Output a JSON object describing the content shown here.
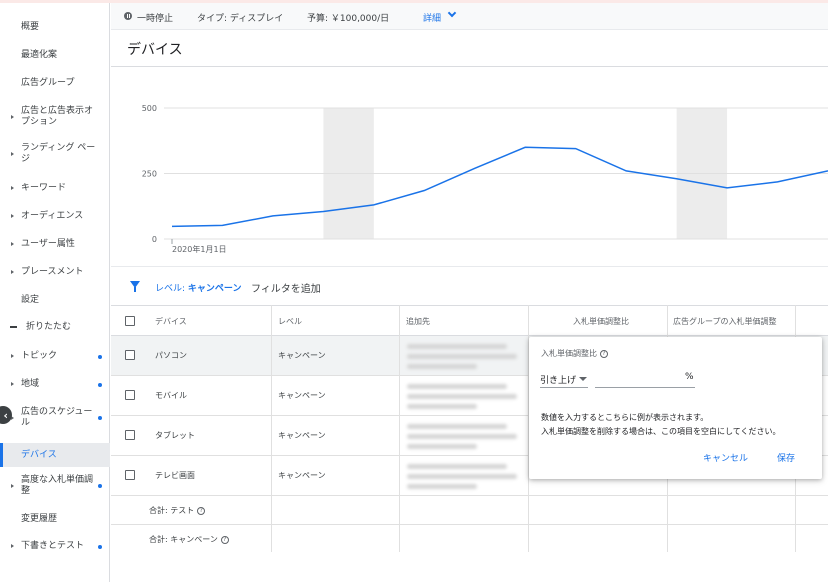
{
  "sidebar": {
    "items": [
      {
        "label": "概要",
        "arrow": false,
        "dot": false
      },
      {
        "label": "最適化案",
        "arrow": false,
        "dot": false
      },
      {
        "label": "広告グループ",
        "arrow": false,
        "dot": false
      },
      {
        "label": "広告と広告表示オプション",
        "arrow": true,
        "dot": false
      },
      {
        "label": "ランディング ページ",
        "arrow": true,
        "dot": false
      },
      {
        "label": "キーワード",
        "arrow": true,
        "dot": false
      },
      {
        "label": "オーディエンス",
        "arrow": true,
        "dot": false
      },
      {
        "label": "ユーザー属性",
        "arrow": true,
        "dot": false
      },
      {
        "label": "プレースメント",
        "arrow": true,
        "dot": false
      },
      {
        "label": "設定",
        "arrow": false,
        "dot": false
      }
    ],
    "collapse_label": "折りたたむ",
    "more_items": [
      {
        "label": "トピック",
        "arrow": true,
        "dot": true
      },
      {
        "label": "地域",
        "arrow": true,
        "dot": true
      },
      {
        "label": "広告のスケジュール",
        "arrow": true,
        "dot": true
      },
      {
        "label": "デバイス",
        "arrow": false,
        "dot": false,
        "active": true
      },
      {
        "label": "高度な入札単価調整",
        "arrow": true,
        "dot": true
      },
      {
        "label": "変更履歴",
        "arrow": false,
        "dot": false
      },
      {
        "label": "下書きとテスト",
        "arrow": true,
        "dot": true
      }
    ],
    "back_glyph": "‹"
  },
  "status_bar": {
    "status": "一時停止",
    "type": "タイプ: ディスプレイ",
    "budget": "予算: ￥100,000/日",
    "details": "詳細"
  },
  "page_title": "デバイス",
  "chart_data": {
    "type": "line",
    "x": [
      "2020年1月1日",
      "",
      "",
      "",
      "",
      "",
      "",
      "",
      "",
      "",
      "",
      "",
      "",
      ""
    ],
    "x_label_shown": "2020年1月1日",
    "series": [
      {
        "values": [
          48,
          52,
          88,
          105,
          130,
          185,
          270,
          350,
          345,
          260,
          230,
          195,
          218,
          260
        ],
        "color": "#1a73e8"
      }
    ],
    "y_ticks": [
      "0",
      "250",
      "500"
    ],
    "ylim": [
      0,
      500
    ],
    "shaded_bands": [
      [
        3,
        4
      ],
      [
        10,
        11
      ]
    ],
    "grid": true
  },
  "filter": {
    "level_prefix": "レベル: ",
    "level_value": "キャンペーン",
    "add_filter": "フィルタを追加"
  },
  "table": {
    "headers": [
      "デバイス",
      "レベル",
      "追加先",
      "入札単価調整比",
      "広告グループの入札単価調整"
    ],
    "rows": [
      {
        "device": "パソコン",
        "level": "キャンペーン"
      },
      {
        "device": "モバイル",
        "level": "キャンペーン"
      },
      {
        "device": "タブレット",
        "level": "キャンペーン"
      },
      {
        "device": "テレビ画面",
        "level": "キャンペーン"
      }
    ],
    "totals": [
      "合計: テスト",
      "合計: キャンペーン"
    ]
  },
  "popup": {
    "title": "入札単価調整比",
    "select_value": "引き上げ",
    "percent": "%",
    "message_1": "数値を入力するとこちらに例が表示されます。",
    "message_2": "入札単価調整を削除する場合は、この項目を空白にしてください。",
    "cancel": "キャンセル",
    "save": "保存"
  },
  "colors": {
    "accent": "#1a73e8"
  }
}
